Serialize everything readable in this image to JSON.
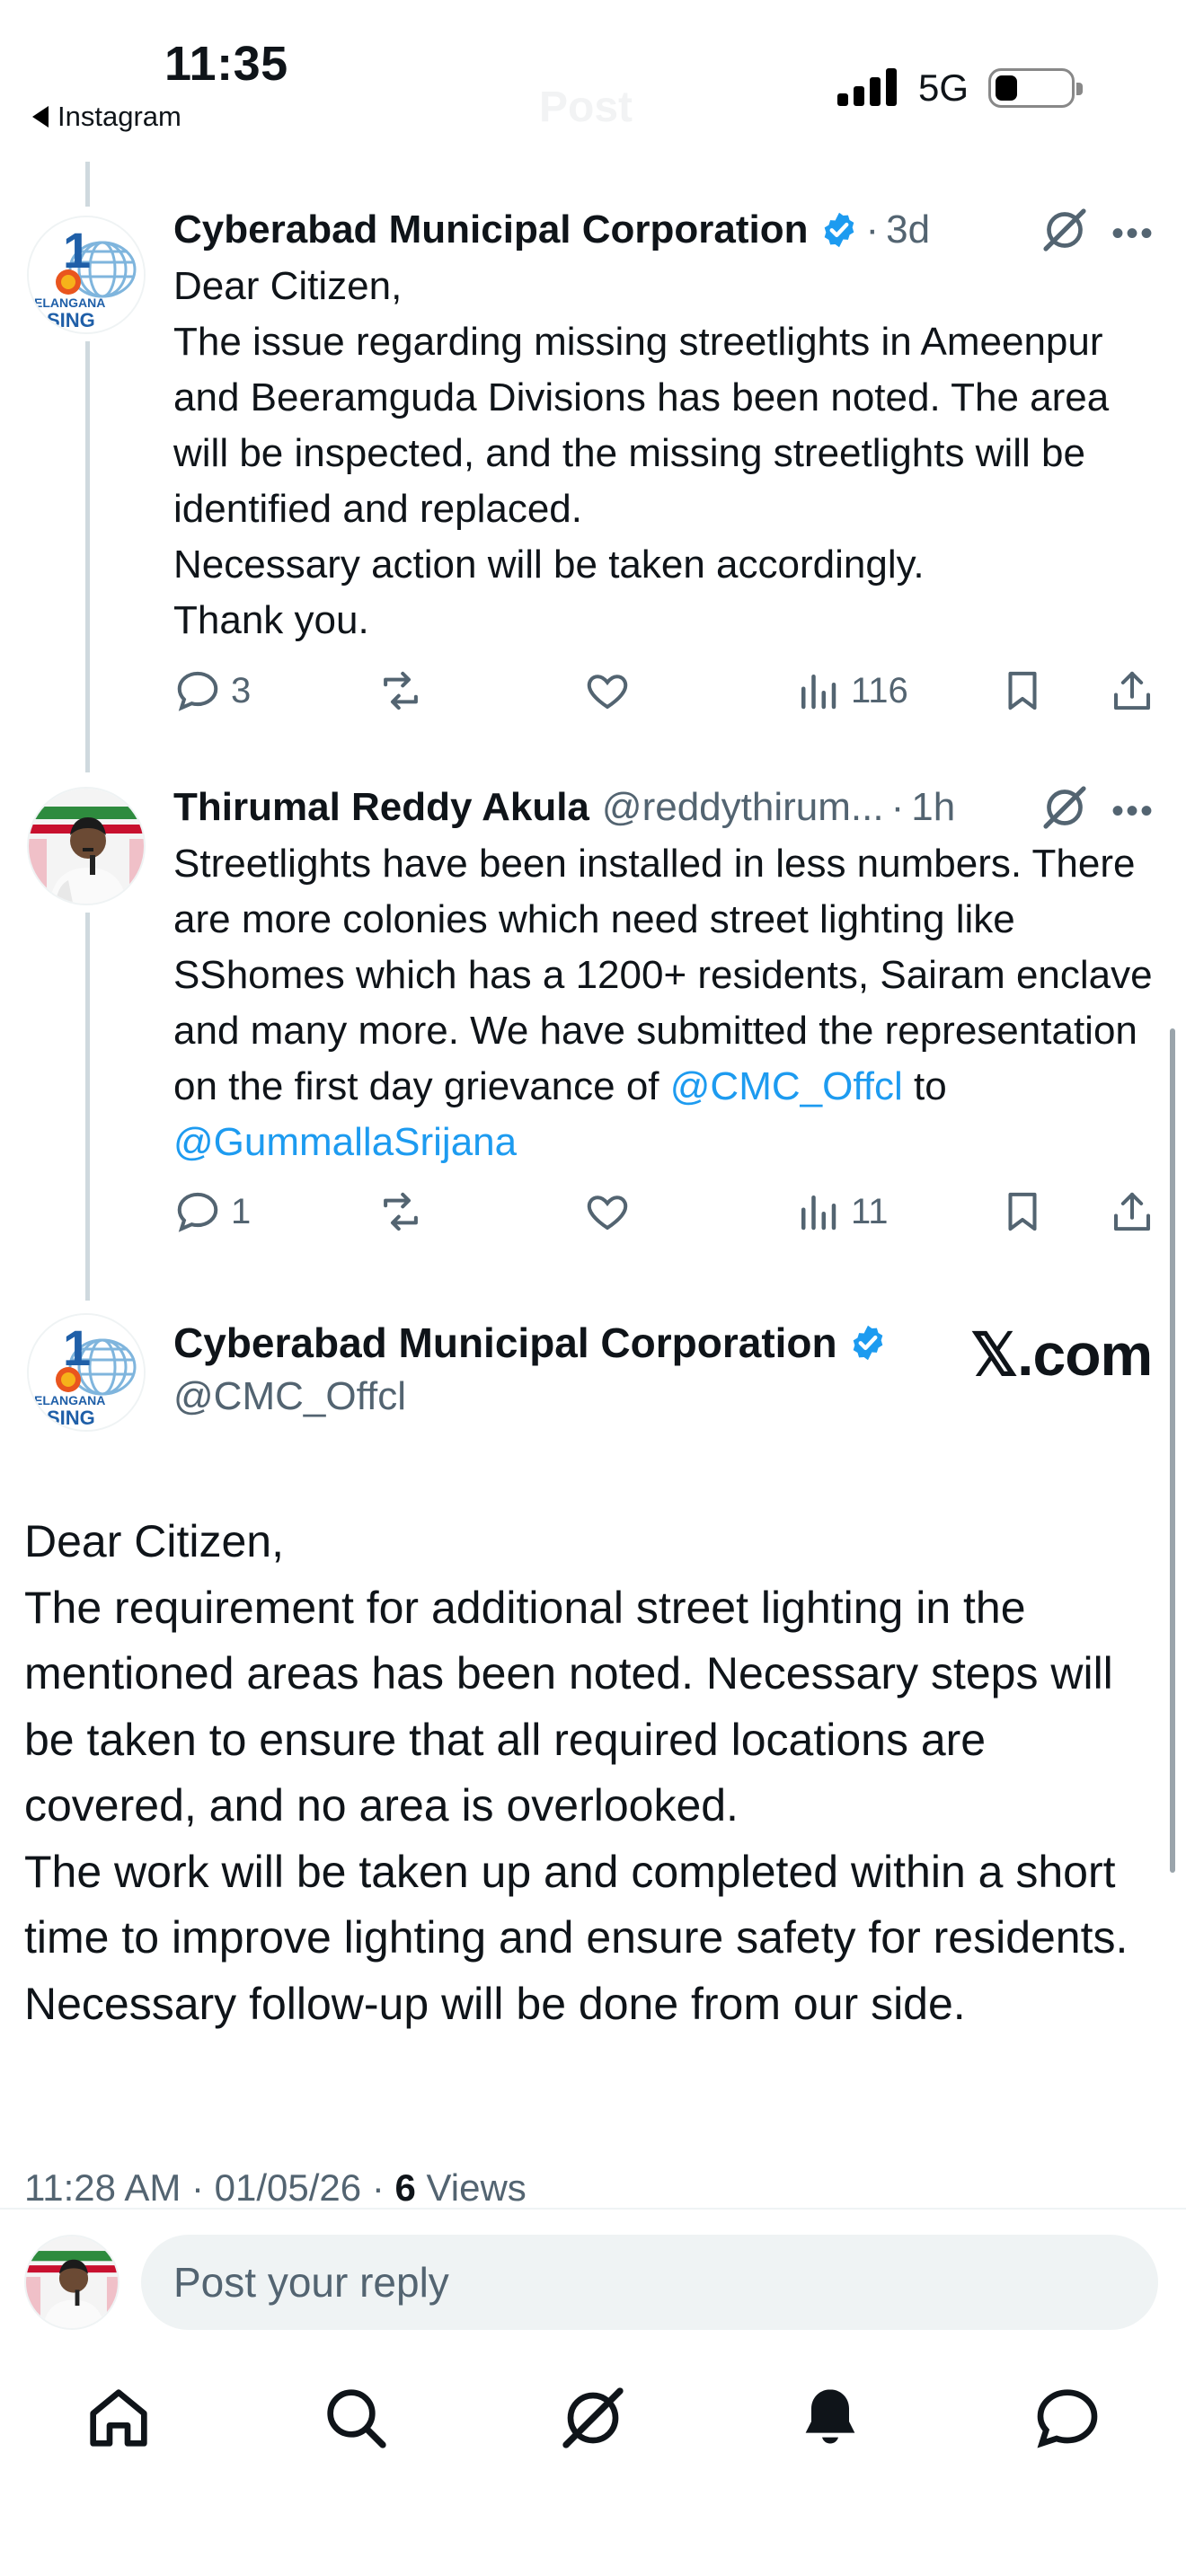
{
  "status_bar": {
    "time": "11:35",
    "back_label": "Instagram",
    "title_ghost": "Post",
    "network": "5G"
  },
  "tweets": [
    {
      "name": "Cyberabad Municipal Corporation",
      "handle": "",
      "dot": "·",
      "time": "3d",
      "verified": true,
      "body": "Dear Citizen,\nThe issue regarding missing streetlights in Ameenpur and Beeramguda Divisions has been noted. The area will be inspected, and the missing streetlights will be identified and replaced.\nNecessary action will be taken accordingly.\nThank you.",
      "replies": "3",
      "views": "116"
    },
    {
      "name": "Thirumal Reddy Akula",
      "handle": "@reddythirum...",
      "dot": "·",
      "time": "1h",
      "verified": false,
      "body_pre": "Streetlights have been installed in less numbers. There are more colonies which need street lighting like SShomes which has a 1200+ residents, Sairam enclave and many more. We have submitted the representation on the first day grievance of ",
      "mention1": "@CMC_Offcl",
      "body_mid": " to ",
      "mention2": "@GummallaSrijana",
      "replies": "1",
      "views": "11"
    }
  ],
  "main_tweet": {
    "name": "Cyberabad Municipal Corporation",
    "handle": "@CMC_Offcl",
    "watermark": "𝕏.com",
    "body": "Dear Citizen,\nThe requirement for additional street lighting in the mentioned areas has been noted. Necessary steps will be taken to ensure that all required locations are covered, and no area is overlooked.\nThe work will be taken up and completed within a short time to improve lighting and ensure safety for residents.\nNecessary follow-up will be done from our side.",
    "meta_time": "11:28 AM · 01/05/26 · ",
    "meta_views_count": "6",
    "meta_views_label": " Views"
  },
  "reply_bar": {
    "placeholder": "Post your reply"
  },
  "avatar_logo": {
    "line1": "ELANGANA",
    "line2": "SING"
  },
  "colors": {
    "accent": "#1d9bf0",
    "text_secondary": "#536471",
    "thread_line": "#cfd9de"
  },
  "icons": {
    "reply": "reply-icon",
    "repost": "repost-icon",
    "like": "heart-icon",
    "views": "views-icon",
    "bookmark": "bookmark-icon",
    "share": "share-icon",
    "grok": "grok-icon",
    "home": "home-icon",
    "search": "search-icon",
    "notifications": "bell-icon",
    "messages": "message-icon"
  }
}
